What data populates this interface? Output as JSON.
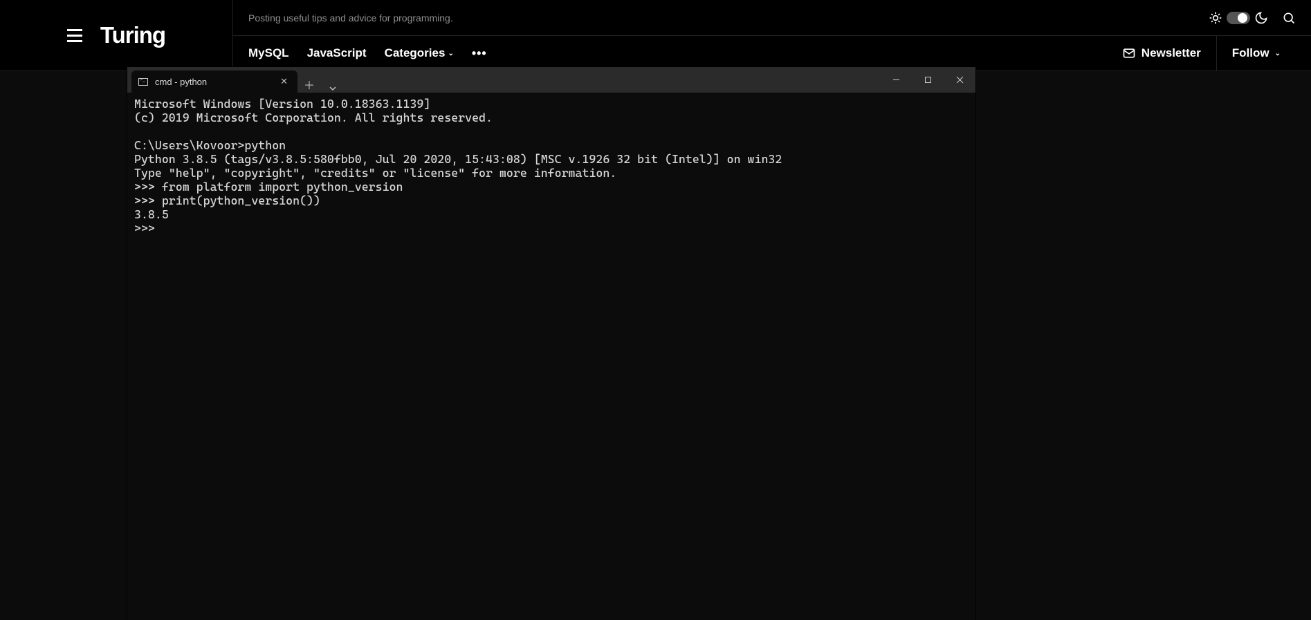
{
  "site": {
    "logo": "Turing",
    "tagline": "Posting useful tips and advice for programming.",
    "nav": {
      "item1": "MySQL",
      "item2": "JavaScript",
      "item3": "Categories",
      "more": "•••"
    },
    "newsletter_label": "Newsletter",
    "follow_label": "Follow"
  },
  "terminal": {
    "tab_title": "cmd - python",
    "lines": {
      "l1": "Microsoft Windows [Version 10.0.18363.1139]",
      "l2": "(c) 2019 Microsoft Corporation. All rights reserved.",
      "l3": "",
      "l4": "C:\\Users\\Kovoor>python",
      "l5": "Python 3.8.5 (tags/v3.8.5:580fbb0, Jul 20 2020, 15:43:08) [MSC v.1926 32 bit (Intel)] on win32",
      "l6": "Type \"help\", \"copyright\", \"credits\" or \"license\" for more information.",
      "l7": ">>> from platform import python_version",
      "l8": ">>> print(python_version())",
      "l9": "3.8.5",
      "l10": ">>> "
    }
  }
}
